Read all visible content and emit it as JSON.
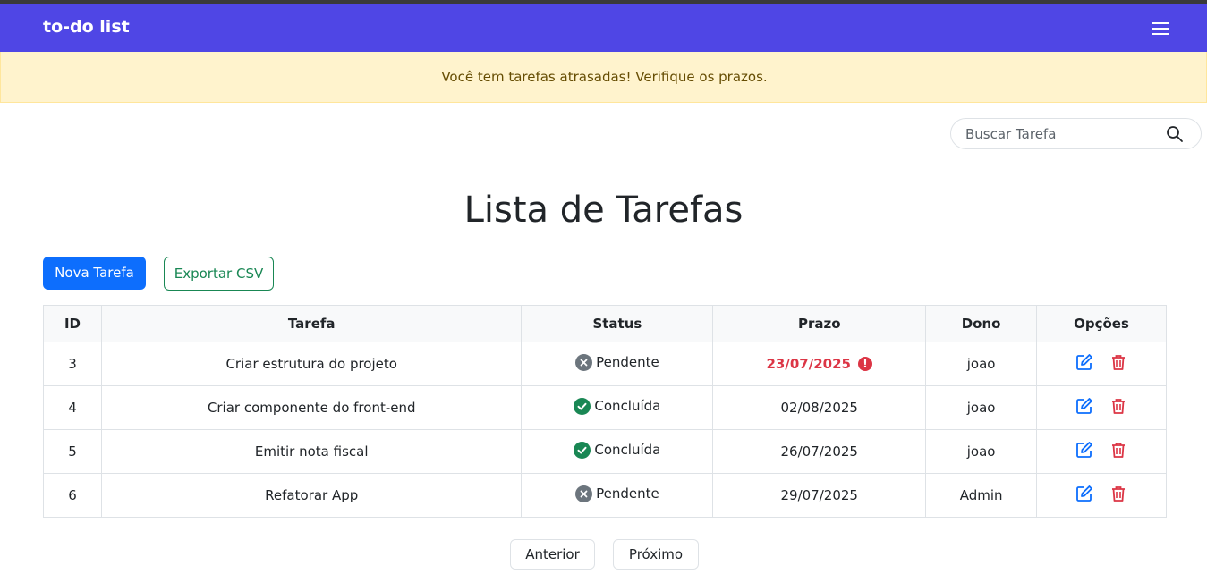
{
  "navbar": {
    "brand": "to-do list",
    "menu_icon": "hamburger-menu-icon",
    "background": "#4f46e5"
  },
  "alert": {
    "text": "Você tem tarefas atrasadas! Verifique os prazos."
  },
  "search": {
    "placeholder": "Buscar Tarefa",
    "value": ""
  },
  "page": {
    "title": "Lista de Tarefas"
  },
  "actions": {
    "new_task": "Nova Tarefa",
    "export_csv": "Exportar CSV"
  },
  "table": {
    "headers": [
      "ID",
      "Tarefa",
      "Status",
      "Prazo",
      "Dono",
      "Opções"
    ],
    "rows": [
      {
        "id": "3",
        "task": "Criar estrutura do projeto",
        "status": "Pendente",
        "status_icon": "x-circle-icon",
        "deadline": "23/07/2025",
        "overdue": true,
        "owner": "joao"
      },
      {
        "id": "4",
        "task": "Criar componente do front-end",
        "status": "Concluída",
        "status_icon": "check-circle-icon",
        "deadline": "02/08/2025",
        "overdue": false,
        "owner": "joao"
      },
      {
        "id": "5",
        "task": "Emitir nota fiscal",
        "status": "Concluída",
        "status_icon": "check-circle-icon",
        "deadline": "26/07/2025",
        "overdue": false,
        "owner": "joao"
      },
      {
        "id": "6",
        "task": "Refatorar App",
        "status": "Pendente",
        "status_icon": "x-circle-icon",
        "deadline": "29/07/2025",
        "overdue": false,
        "owner": "Admin"
      }
    ]
  },
  "pagination": {
    "prev": "Anterior",
    "next": "Próximo"
  },
  "colors": {
    "primary": "#0d6efd",
    "success": "#198754",
    "danger": "#dc3545",
    "secondary": "#6c757d",
    "alert_bg": "#fff3cd"
  }
}
